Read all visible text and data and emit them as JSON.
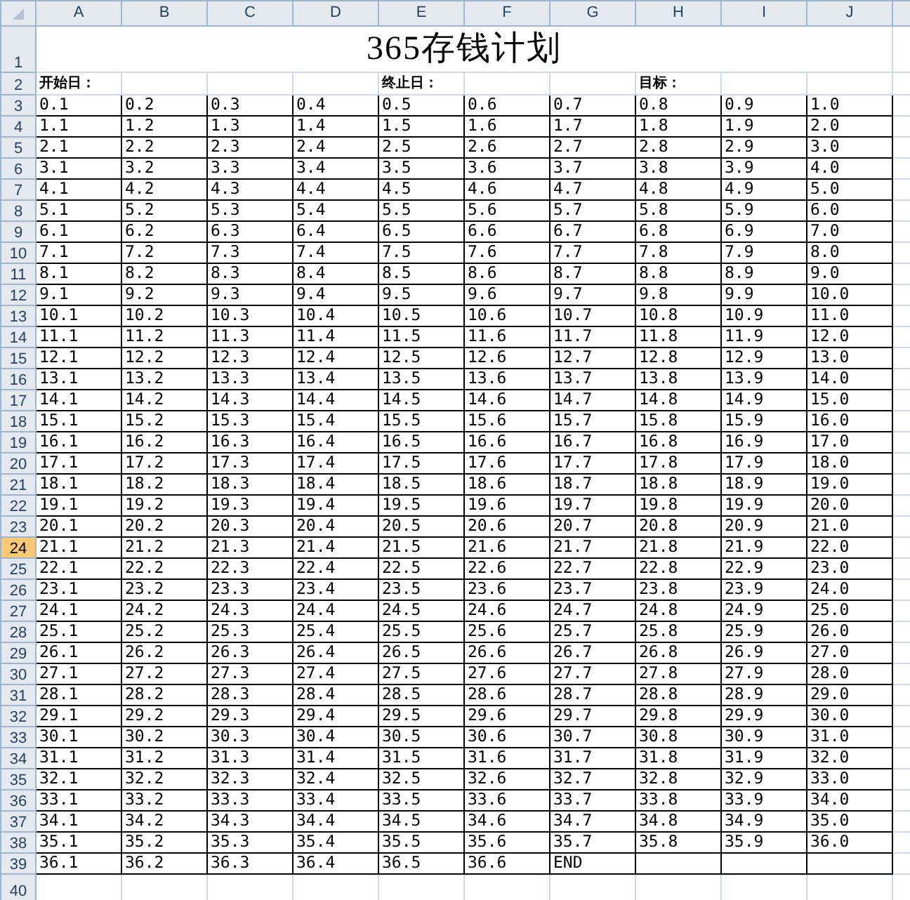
{
  "title": "365存钱计划",
  "fields": [
    {
      "label": "开始日："
    },
    {
      "label": "终止日："
    },
    {
      "label": "目标："
    }
  ],
  "columns": [
    {
      "label": "A",
      "selected": false
    },
    {
      "label": "B",
      "selected": false
    },
    {
      "label": "C",
      "selected": false
    },
    {
      "label": "D",
      "selected": false
    },
    {
      "label": "E",
      "selected": false
    },
    {
      "label": "F",
      "selected": false
    },
    {
      "label": "G",
      "selected": false
    },
    {
      "label": "H",
      "selected": false
    },
    {
      "label": "I",
      "selected": false
    },
    {
      "label": "J",
      "selected": false
    }
  ],
  "rows": [
    {
      "label": "1",
      "selected": false
    },
    {
      "label": "2",
      "selected": false
    },
    {
      "label": "3",
      "selected": false
    },
    {
      "label": "4",
      "selected": false
    },
    {
      "label": "5",
      "selected": false
    },
    {
      "label": "6",
      "selected": false
    },
    {
      "label": "7",
      "selected": false
    },
    {
      "label": "8",
      "selected": false
    },
    {
      "label": "9",
      "selected": false
    },
    {
      "label": "10",
      "selected": false
    },
    {
      "label": "11",
      "selected": false
    },
    {
      "label": "12",
      "selected": false
    },
    {
      "label": "13",
      "selected": false
    },
    {
      "label": "14",
      "selected": false
    },
    {
      "label": "15",
      "selected": false
    },
    {
      "label": "16",
      "selected": false
    },
    {
      "label": "17",
      "selected": false
    },
    {
      "label": "18",
      "selected": false
    },
    {
      "label": "19",
      "selected": false
    },
    {
      "label": "20",
      "selected": false
    },
    {
      "label": "21",
      "selected": false
    },
    {
      "label": "22",
      "selected": false
    },
    {
      "label": "23",
      "selected": false
    },
    {
      "label": "24",
      "selected": true
    },
    {
      "label": "25",
      "selected": false
    },
    {
      "label": "26",
      "selected": false
    },
    {
      "label": "27",
      "selected": false
    },
    {
      "label": "28",
      "selected": false
    },
    {
      "label": "29",
      "selected": false
    },
    {
      "label": "30",
      "selected": false
    },
    {
      "label": "31",
      "selected": false
    },
    {
      "label": "32",
      "selected": false
    },
    {
      "label": "33",
      "selected": false
    },
    {
      "label": "34",
      "selected": false
    },
    {
      "label": "35",
      "selected": false
    },
    {
      "label": "36",
      "selected": false
    },
    {
      "label": "37",
      "selected": false
    },
    {
      "label": "38",
      "selected": false
    },
    {
      "label": "39",
      "selected": false
    },
    {
      "label": "40",
      "selected": false
    }
  ],
  "data": [
    [
      "0.1",
      "0.2",
      "0.3",
      "0.4",
      "0.5",
      "0.6",
      "0.7",
      "0.8",
      "0.9",
      "1.0"
    ],
    [
      "1.1",
      "1.2",
      "1.3",
      "1.4",
      "1.5",
      "1.6",
      "1.7",
      "1.8",
      "1.9",
      "2.0"
    ],
    [
      "2.1",
      "2.2",
      "2.3",
      "2.4",
      "2.5",
      "2.6",
      "2.7",
      "2.8",
      "2.9",
      "3.0"
    ],
    [
      "3.1",
      "3.2",
      "3.3",
      "3.4",
      "3.5",
      "3.6",
      "3.7",
      "3.8",
      "3.9",
      "4.0"
    ],
    [
      "4.1",
      "4.2",
      "4.3",
      "4.4",
      "4.5",
      "4.6",
      "4.7",
      "4.8",
      "4.9",
      "5.0"
    ],
    [
      "5.1",
      "5.2",
      "5.3",
      "5.4",
      "5.5",
      "5.6",
      "5.7",
      "5.8",
      "5.9",
      "6.0"
    ],
    [
      "6.1",
      "6.2",
      "6.3",
      "6.4",
      "6.5",
      "6.6",
      "6.7",
      "6.8",
      "6.9",
      "7.0"
    ],
    [
      "7.1",
      "7.2",
      "7.3",
      "7.4",
      "7.5",
      "7.6",
      "7.7",
      "7.8",
      "7.9",
      "8.0"
    ],
    [
      "8.1",
      "8.2",
      "8.3",
      "8.4",
      "8.5",
      "8.6",
      "8.7",
      "8.8",
      "8.9",
      "9.0"
    ],
    [
      "9.1",
      "9.2",
      "9.3",
      "9.4",
      "9.5",
      "9.6",
      "9.7",
      "9.8",
      "9.9",
      "10.0"
    ],
    [
      "10.1",
      "10.2",
      "10.3",
      "10.4",
      "10.5",
      "10.6",
      "10.7",
      "10.8",
      "10.9",
      "11.0"
    ],
    [
      "11.1",
      "11.2",
      "11.3",
      "11.4",
      "11.5",
      "11.6",
      "11.7",
      "11.8",
      "11.9",
      "12.0"
    ],
    [
      "12.1",
      "12.2",
      "12.3",
      "12.4",
      "12.5",
      "12.6",
      "12.7",
      "12.8",
      "12.9",
      "13.0"
    ],
    [
      "13.1",
      "13.2",
      "13.3",
      "13.4",
      "13.5",
      "13.6",
      "13.7",
      "13.8",
      "13.9",
      "14.0"
    ],
    [
      "14.1",
      "14.2",
      "14.3",
      "14.4",
      "14.5",
      "14.6",
      "14.7",
      "14.8",
      "14.9",
      "15.0"
    ],
    [
      "15.1",
      "15.2",
      "15.3",
      "15.4",
      "15.5",
      "15.6",
      "15.7",
      "15.8",
      "15.9",
      "16.0"
    ],
    [
      "16.1",
      "16.2",
      "16.3",
      "16.4",
      "16.5",
      "16.6",
      "16.7",
      "16.8",
      "16.9",
      "17.0"
    ],
    [
      "17.1",
      "17.2",
      "17.3",
      "17.4",
      "17.5",
      "17.6",
      "17.7",
      "17.8",
      "17.9",
      "18.0"
    ],
    [
      "18.1",
      "18.2",
      "18.3",
      "18.4",
      "18.5",
      "18.6",
      "18.7",
      "18.8",
      "18.9",
      "19.0"
    ],
    [
      "19.1",
      "19.2",
      "19.3",
      "19.4",
      "19.5",
      "19.6",
      "19.7",
      "19.8",
      "19.9",
      "20.0"
    ],
    [
      "20.1",
      "20.2",
      "20.3",
      "20.4",
      "20.5",
      "20.6",
      "20.7",
      "20.8",
      "20.9",
      "21.0"
    ],
    [
      "21.1",
      "21.2",
      "21.3",
      "21.4",
      "21.5",
      "21.6",
      "21.7",
      "21.8",
      "21.9",
      "22.0"
    ],
    [
      "22.1",
      "22.2",
      "22.3",
      "22.4",
      "22.5",
      "22.6",
      "22.7",
      "22.8",
      "22.9",
      "23.0"
    ],
    [
      "23.1",
      "23.2",
      "23.3",
      "23.4",
      "23.5",
      "23.6",
      "23.7",
      "23.8",
      "23.9",
      "24.0"
    ],
    [
      "24.1",
      "24.2",
      "24.3",
      "24.4",
      "24.5",
      "24.6",
      "24.7",
      "24.8",
      "24.9",
      "25.0"
    ],
    [
      "25.1",
      "25.2",
      "25.3",
      "25.4",
      "25.5",
      "25.6",
      "25.7",
      "25.8",
      "25.9",
      "26.0"
    ],
    [
      "26.1",
      "26.2",
      "26.3",
      "26.4",
      "26.5",
      "26.6",
      "26.7",
      "26.8",
      "26.9",
      "27.0"
    ],
    [
      "27.1",
      "27.2",
      "27.3",
      "27.4",
      "27.5",
      "27.6",
      "27.7",
      "27.8",
      "27.9",
      "28.0"
    ],
    [
      "28.1",
      "28.2",
      "28.3",
      "28.4",
      "28.5",
      "28.6",
      "28.7",
      "28.8",
      "28.9",
      "29.0"
    ],
    [
      "29.1",
      "29.2",
      "29.3",
      "29.4",
      "29.5",
      "29.6",
      "29.7",
      "29.8",
      "29.9",
      "30.0"
    ],
    [
      "30.1",
      "30.2",
      "30.3",
      "30.4",
      "30.5",
      "30.6",
      "30.7",
      "30.8",
      "30.9",
      "31.0"
    ],
    [
      "31.1",
      "31.2",
      "31.3",
      "31.4",
      "31.5",
      "31.6",
      "31.7",
      "31.8",
      "31.9",
      "32.0"
    ],
    [
      "32.1",
      "32.2",
      "32.3",
      "32.4",
      "32.5",
      "32.6",
      "32.7",
      "32.8",
      "32.9",
      "33.0"
    ],
    [
      "33.1",
      "33.2",
      "33.3",
      "33.4",
      "33.5",
      "33.6",
      "33.7",
      "33.8",
      "33.9",
      "34.0"
    ],
    [
      "34.1",
      "34.2",
      "34.3",
      "34.4",
      "34.5",
      "34.6",
      "34.7",
      "34.8",
      "34.9",
      "35.0"
    ],
    [
      "35.1",
      "35.2",
      "35.3",
      "35.4",
      "35.5",
      "35.6",
      "35.7",
      "35.8",
      "35.9",
      "36.0"
    ],
    [
      "36.1",
      "36.2",
      "36.3",
      "36.4",
      "36.5",
      "36.6",
      "END"
    ]
  ]
}
